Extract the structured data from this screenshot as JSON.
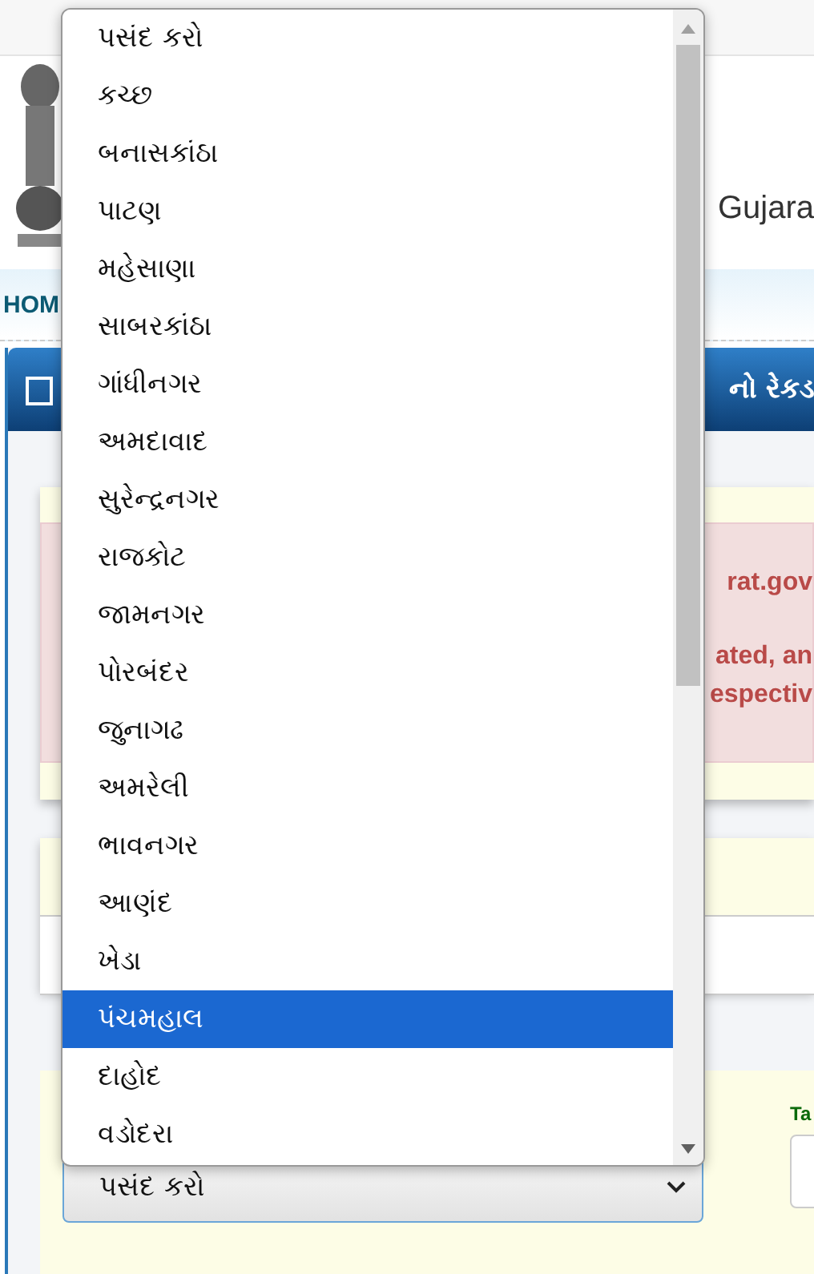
{
  "header": {
    "title_fragment": "Gujara"
  },
  "breadcrumb": {
    "fragment": "HOM"
  },
  "title_bar": {
    "fragment": "નો રેકડ"
  },
  "alert": {
    "lines": [
      "rat.gov",
      "ated, an",
      "espectiv"
    ]
  },
  "district_select": {
    "value": "પસંદ કરો",
    "expanded": true
  },
  "right_field": {
    "label_fragment": "Ta"
  },
  "options": [
    {
      "label": "પસંદ કરો",
      "selected": false
    },
    {
      "label": "કચ્છ",
      "selected": false
    },
    {
      "label": "બનાસકાંઠા",
      "selected": false
    },
    {
      "label": "પાટણ",
      "selected": false
    },
    {
      "label": "મહેસાણા",
      "selected": false
    },
    {
      "label": "સાબરકાંઠા",
      "selected": false
    },
    {
      "label": "ગાંધીનગર",
      "selected": false
    },
    {
      "label": "અમદાવાદ",
      "selected": false
    },
    {
      "label": "સુરેન્દ્રનગર",
      "selected": false
    },
    {
      "label": "રાજકોટ",
      "selected": false
    },
    {
      "label": "જામનગર",
      "selected": false
    },
    {
      "label": "પોરબંદર",
      "selected": false
    },
    {
      "label": "જુનાગઢ",
      "selected": false
    },
    {
      "label": "અમરેલી",
      "selected": false
    },
    {
      "label": "ભાવનગર",
      "selected": false
    },
    {
      "label": "આણંદ",
      "selected": false
    },
    {
      "label": "ખેડા",
      "selected": false
    },
    {
      "label": "પંચમહાલ",
      "selected": true
    },
    {
      "label": "દાહોદ",
      "selected": false
    },
    {
      "label": "વડોદરા",
      "selected": false
    }
  ]
}
